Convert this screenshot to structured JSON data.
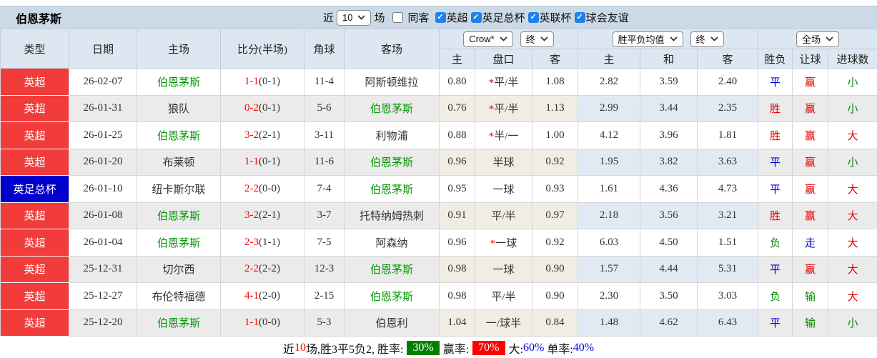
{
  "title": "伯恩茅斯",
  "filter": {
    "recent_label": "近",
    "recent_value": "10",
    "games_label": "场",
    "same_away_label": "同客",
    "same_away_checked": false,
    "leagues": [
      {
        "label": "英超",
        "checked": true
      },
      {
        "label": "英足总杯",
        "checked": true
      },
      {
        "label": "英联杯",
        "checked": true
      },
      {
        "label": "球会友谊",
        "checked": true
      }
    ]
  },
  "table": {
    "columns": [
      "类型",
      "日期",
      "主场",
      "比分(半场)",
      "角球",
      "客场"
    ],
    "group_headers": {
      "odds_source": "Crow*",
      "odds_time": "终",
      "avg_label": "胜平负均值",
      "avg_time": "终",
      "scope_label": "全场"
    },
    "sub_headers": [
      "主",
      "盘口",
      "客",
      "主",
      "和",
      "客",
      "胜负",
      "让球",
      "进球数"
    ],
    "rows": [
      {
        "type": "英超",
        "type_color": "red",
        "date": "26-02-07",
        "home": "伯恩茅斯",
        "score": "1-1",
        "half": "(0-1)",
        "corners": "11-4",
        "away": "阿斯顿维拉",
        "odds_home": "0.80",
        "handicap": "平/半",
        "handicap_star": true,
        "odds_away": "1.08",
        "avg_home": "2.82",
        "avg_draw": "3.59",
        "avg_away": "2.40",
        "result": "平",
        "handicap_result": "赢",
        "goals": "小"
      },
      {
        "type": "英超",
        "type_color": "red",
        "date": "26-01-31",
        "home": "狼队",
        "score": "0-2",
        "half": "(0-1)",
        "corners": "5-6",
        "away": "伯恩茅斯",
        "odds_home": "0.76",
        "handicap": "平/半",
        "handicap_star": true,
        "odds_away": "1.13",
        "avg_home": "2.99",
        "avg_draw": "3.44",
        "avg_away": "2.35",
        "result": "胜",
        "handicap_result": "赢",
        "goals": "小"
      },
      {
        "type": "英超",
        "type_color": "red",
        "date": "26-01-25",
        "home": "伯恩茅斯",
        "score": "3-2",
        "half": "(2-1)",
        "corners": "3-11",
        "away": "利物浦",
        "odds_home": "0.88",
        "handicap": "半/一",
        "handicap_star": true,
        "odds_away": "1.00",
        "avg_home": "4.12",
        "avg_draw": "3.96",
        "avg_away": "1.81",
        "result": "胜",
        "handicap_result": "赢",
        "goals": "大"
      },
      {
        "type": "英超",
        "type_color": "red",
        "date": "26-01-20",
        "home": "布莱顿",
        "score": "1-1",
        "half": "(0-1)",
        "corners": "11-6",
        "away": "伯恩茅斯",
        "odds_home": "0.96",
        "handicap": "半球",
        "handicap_star": false,
        "odds_away": "0.92",
        "avg_home": "1.95",
        "avg_draw": "3.82",
        "avg_away": "3.63",
        "result": "平",
        "handicap_result": "赢",
        "goals": "小"
      },
      {
        "type": "英足总杯",
        "type_color": "blue",
        "date": "26-01-10",
        "home": "纽卡斯尔联",
        "score": "2-2",
        "half": "(0-0)",
        "corners": "7-4",
        "away": "伯恩茅斯",
        "odds_home": "0.95",
        "handicap": "一球",
        "handicap_star": false,
        "odds_away": "0.93",
        "avg_home": "1.61",
        "avg_draw": "4.36",
        "avg_away": "4.73",
        "result": "平",
        "handicap_result": "赢",
        "goals": "大"
      },
      {
        "type": "英超",
        "type_color": "red",
        "date": "26-01-08",
        "home": "伯恩茅斯",
        "score": "3-2",
        "half": "(2-1)",
        "corners": "3-7",
        "away": "托特纳姆热刺",
        "odds_home": "0.91",
        "handicap": "平/半",
        "handicap_star": false,
        "odds_away": "0.97",
        "avg_home": "2.18",
        "avg_draw": "3.56",
        "avg_away": "3.21",
        "result": "胜",
        "handicap_result": "赢",
        "goals": "大"
      },
      {
        "type": "英超",
        "type_color": "red",
        "date": "26-01-04",
        "home": "伯恩茅斯",
        "score": "2-3",
        "half": "(1-1)",
        "corners": "7-5",
        "away": "阿森纳",
        "odds_home": "0.96",
        "handicap": "一球",
        "handicap_star": true,
        "odds_away": "0.92",
        "avg_home": "6.03",
        "avg_draw": "4.50",
        "avg_away": "1.51",
        "result": "负",
        "handicap_result": "走",
        "goals": "大"
      },
      {
        "type": "英超",
        "type_color": "red",
        "date": "25-12-31",
        "home": "切尔西",
        "score": "2-2",
        "half": "(2-2)",
        "corners": "12-3",
        "away": "伯恩茅斯",
        "odds_home": "0.98",
        "handicap": "一球",
        "handicap_star": false,
        "odds_away": "0.90",
        "avg_home": "1.57",
        "avg_draw": "4.44",
        "avg_away": "5.31",
        "result": "平",
        "handicap_result": "赢",
        "goals": "大"
      },
      {
        "type": "英超",
        "type_color": "red",
        "date": "25-12-27",
        "home": "布伦特福德",
        "score": "4-1",
        "half": "(2-0)",
        "corners": "2-15",
        "away": "伯恩茅斯",
        "odds_home": "0.98",
        "handicap": "平/半",
        "handicap_star": false,
        "odds_away": "0.90",
        "avg_home": "2.30",
        "avg_draw": "3.50",
        "avg_away": "3.03",
        "result": "负",
        "handicap_result": "输",
        "goals": "大"
      },
      {
        "type": "英超",
        "type_color": "red",
        "date": "25-12-20",
        "home": "伯恩茅斯",
        "score": "1-1",
        "half": "(0-0)",
        "corners": "5-3",
        "away": "伯恩利",
        "odds_home": "1.04",
        "handicap": "一/球半",
        "handicap_star": false,
        "odds_away": "0.84",
        "avg_home": "1.48",
        "avg_draw": "4.62",
        "avg_away": "6.43",
        "result": "平",
        "handicap_result": "输",
        "goals": "小"
      }
    ]
  },
  "summary": {
    "prefix": "近",
    "count": "10",
    "mid": "场,胜3平5负2, 胜率:",
    "win_rate": "30%",
    "handicap_label": "赢率:",
    "handicap_rate": "70%",
    "over_label": "大:",
    "over_rate": "60%",
    "single_label": "单率:",
    "single_rate": "40%"
  },
  "colors": {
    "type_red": "#f23c3c",
    "type_blue": "#0000cc",
    "team_highlight": "#009900",
    "score_red": "#ff0000",
    "semantic": {
      "胜": "#e60000",
      "平": "#0000cc",
      "负": "#008800",
      "赢": "#e60000",
      "走": "#0000cc",
      "输": "#008800",
      "大": "#e60000",
      "小": "#008800"
    },
    "win_rate_badge": "#008000",
    "handicap_rate_badge": "#ff0000",
    "percent_blue": "#0000ee"
  }
}
